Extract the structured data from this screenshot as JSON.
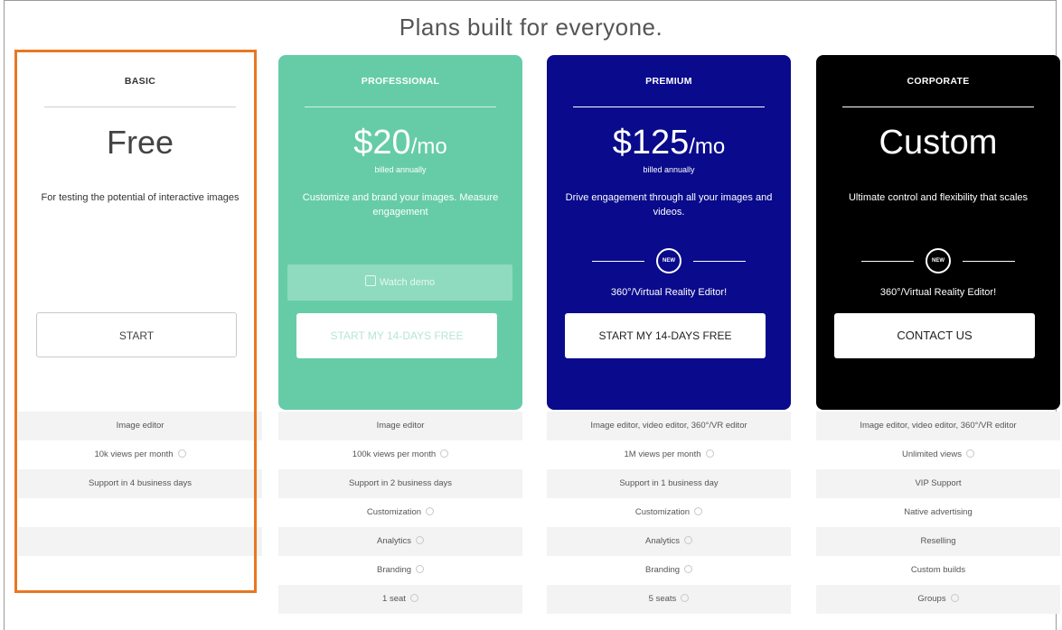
{
  "title": "Plans built for everyone.",
  "plans": {
    "basic": {
      "name": "BASIC",
      "price": "Free",
      "description": "For testing the potential of interactive images",
      "button": "START",
      "features": [
        {
          "label": "Image editor",
          "info": false
        },
        {
          "label": "10k views per month",
          "info": true
        },
        {
          "label": "Support in 4 business days",
          "info": false
        },
        {
          "label": "",
          "info": false
        },
        {
          "label": "",
          "info": false
        },
        {
          "label": "",
          "info": false
        }
      ]
    },
    "professional": {
      "name": "PROFESSIONAL",
      "price": "$20",
      "price_unit": "/mo",
      "billing": "billed annually",
      "description": "Customize and brand your images. Measure engagement",
      "button": "START MY 14-DAYS FREE",
      "secondary_button": "Watch demo",
      "features": [
        {
          "label": "Image editor",
          "info": false
        },
        {
          "label": "100k views per month",
          "info": true
        },
        {
          "label": "Support in 2 business days",
          "info": false
        },
        {
          "label": "Customization",
          "info": true
        },
        {
          "label": "Analytics",
          "info": true
        },
        {
          "label": "Branding",
          "info": true
        },
        {
          "label": "1 seat",
          "info": true
        }
      ]
    },
    "premium": {
      "name": "PREMIUM",
      "price": "$125",
      "price_unit": "/mo",
      "billing": "billed annually",
      "description": "Drive engagement through all your images and videos.",
      "badge": "NEW",
      "badge_text": "360°/Virtual Reality Editor!",
      "button": "START MY 14-DAYS FREE",
      "features": [
        {
          "label": "Image editor, video editor, 360°/VR editor",
          "info": false
        },
        {
          "label": "1M views per month",
          "info": true
        },
        {
          "label": "Support in 1 business day",
          "info": false
        },
        {
          "label": "Customization",
          "info": true
        },
        {
          "label": "Analytics",
          "info": true
        },
        {
          "label": "Branding",
          "info": true
        },
        {
          "label": "5 seats",
          "info": true
        }
      ]
    },
    "corporate": {
      "name": "CORPORATE",
      "price": "Custom",
      "description": "Ultimate control and flexibility that scales",
      "badge": "NEW",
      "badge_text": "360°/Virtual Reality Editor!",
      "button": "CONTACT US",
      "features": [
        {
          "label": "Image editor, video editor, 360°/VR editor",
          "info": false
        },
        {
          "label": "Unlimited views",
          "info": true
        },
        {
          "label": "VIP Support",
          "info": false
        },
        {
          "label": "Native advertising",
          "info": false
        },
        {
          "label": "Reselling",
          "info": false
        },
        {
          "label": "Custom builds",
          "info": false
        },
        {
          "label": "Groups",
          "info": true
        }
      ]
    }
  },
  "colors": {
    "highlight": "#e87722",
    "professional": "#66cca8",
    "premium": "#0a0a8c",
    "corporate": "#000000"
  }
}
